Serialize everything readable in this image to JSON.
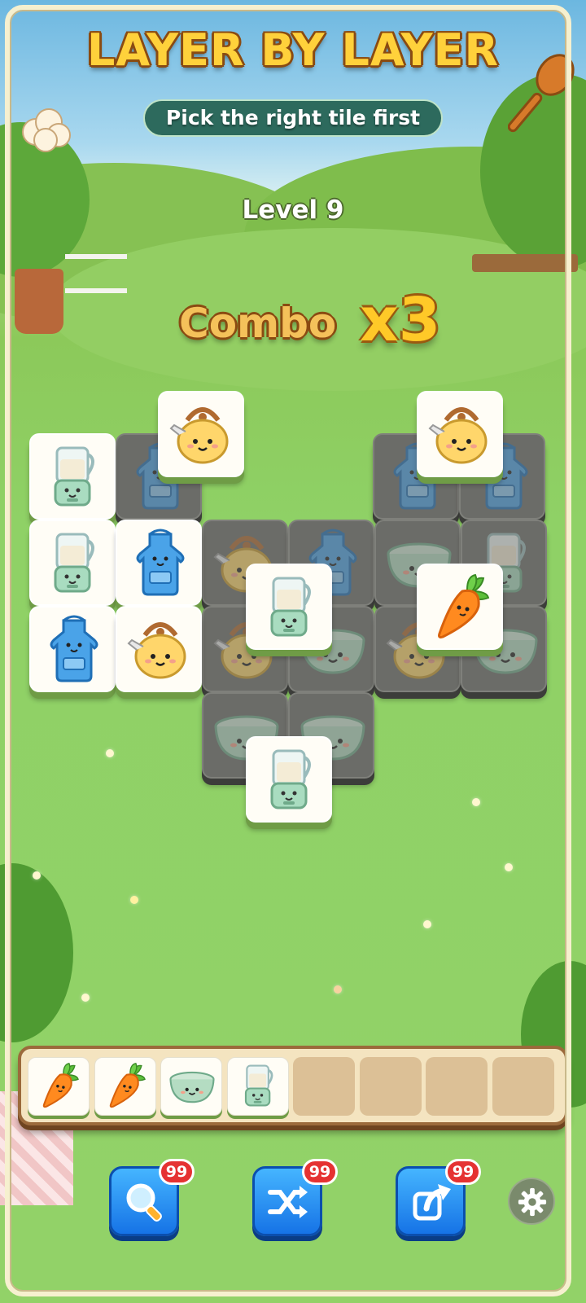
{
  "header": {
    "title": "LAYER BY LAYER",
    "subtitle": "Pick the right tile first"
  },
  "level": {
    "label": "Level 9"
  },
  "combo": {
    "label": "Combo",
    "multiplier": "x3"
  },
  "board": {
    "tiles": [
      {
        "item": "blender",
        "state": "top"
      },
      {
        "item": "apron",
        "state": "blocked"
      },
      {
        "item": "kettle",
        "state": "top"
      },
      {
        "item": "apron",
        "state": "blocked"
      },
      {
        "item": "apron",
        "state": "blocked"
      },
      {
        "item": "kettle",
        "state": "top"
      },
      {
        "item": "blender",
        "state": "top"
      },
      {
        "item": "apron",
        "state": "top"
      },
      {
        "item": "kettle",
        "state": "blocked"
      },
      {
        "item": "apron",
        "state": "blocked"
      },
      {
        "item": "bowl",
        "state": "blocked"
      },
      {
        "item": "blender",
        "state": "blocked"
      },
      {
        "item": "apron",
        "state": "top"
      },
      {
        "item": "kettle",
        "state": "top"
      },
      {
        "item": "kettle",
        "state": "blocked"
      },
      {
        "item": "bowl",
        "state": "blocked"
      },
      {
        "item": "kettle",
        "state": "blocked"
      },
      {
        "item": "bowl",
        "state": "blocked"
      },
      {
        "item": "blender",
        "state": "top"
      },
      {
        "item": "carrot",
        "state": "top"
      },
      {
        "item": "bowl",
        "state": "blocked"
      },
      {
        "item": "bowl",
        "state": "blocked"
      },
      {
        "item": "blender",
        "state": "top"
      }
    ]
  },
  "tray": {
    "capacity": 8,
    "slots": [
      "carrot",
      "carrot",
      "bowl",
      "blender",
      "",
      "",
      "",
      ""
    ]
  },
  "powerups": [
    {
      "name": "hint",
      "icon": "magnifier-icon",
      "count": "99"
    },
    {
      "name": "shuffle",
      "icon": "shuffle-icon",
      "count": "99"
    },
    {
      "name": "undo",
      "icon": "undo-arrow-icon",
      "count": "99"
    }
  ],
  "settings": {
    "icon": "gear-icon"
  },
  "colors": {
    "title": "#ffd13b",
    "outline": "#8a4b12",
    "button": "#1f8bf0",
    "badge": "#e53232",
    "tray": "#f4e4c0"
  }
}
